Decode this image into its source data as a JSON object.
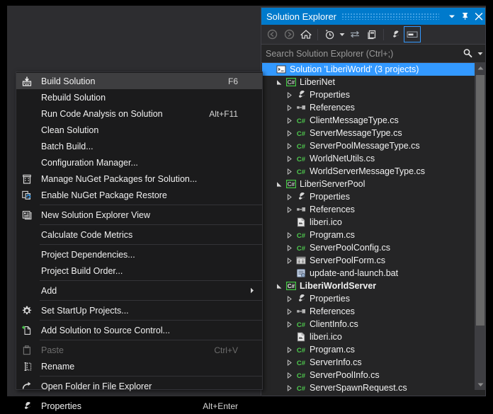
{
  "context_menu": {
    "items": [
      {
        "label": "Build Solution",
        "shortcut": "F6",
        "icon": "build-solution-icon",
        "highlighted": true,
        "disabled": false,
        "submenu": false,
        "sep_after": false
      },
      {
        "label": "Rebuild Solution",
        "shortcut": "",
        "icon": "",
        "highlighted": false,
        "disabled": false,
        "submenu": false,
        "sep_after": false
      },
      {
        "label": "Run Code Analysis on Solution",
        "shortcut": "Alt+F11",
        "icon": "",
        "highlighted": false,
        "disabled": false,
        "submenu": false,
        "sep_after": false
      },
      {
        "label": "Clean Solution",
        "shortcut": "",
        "icon": "",
        "highlighted": false,
        "disabled": false,
        "submenu": false,
        "sep_after": false
      },
      {
        "label": "Batch Build...",
        "shortcut": "",
        "icon": "",
        "highlighted": false,
        "disabled": false,
        "submenu": false,
        "sep_after": false
      },
      {
        "label": "Configuration Manager...",
        "shortcut": "",
        "icon": "",
        "highlighted": false,
        "disabled": false,
        "submenu": false,
        "sep_after": false
      },
      {
        "label": "Manage NuGet Packages for Solution...",
        "shortcut": "",
        "icon": "nuget-package-icon",
        "highlighted": false,
        "disabled": false,
        "submenu": false,
        "sep_after": false
      },
      {
        "label": "Enable NuGet Package Restore",
        "shortcut": "",
        "icon": "nuget-restore-icon",
        "highlighted": false,
        "disabled": false,
        "submenu": false,
        "sep_after": true
      },
      {
        "label": "New Solution Explorer View",
        "shortcut": "",
        "icon": "new-view-icon",
        "highlighted": false,
        "disabled": false,
        "submenu": false,
        "sep_after": true
      },
      {
        "label": "Calculate Code Metrics",
        "shortcut": "",
        "icon": "",
        "highlighted": false,
        "disabled": false,
        "submenu": false,
        "sep_after": true
      },
      {
        "label": "Project Dependencies...",
        "shortcut": "",
        "icon": "",
        "highlighted": false,
        "disabled": false,
        "submenu": false,
        "sep_after": false
      },
      {
        "label": "Project Build Order...",
        "shortcut": "",
        "icon": "",
        "highlighted": false,
        "disabled": false,
        "submenu": false,
        "sep_after": true
      },
      {
        "label": "Add",
        "shortcut": "",
        "icon": "",
        "highlighted": false,
        "disabled": false,
        "submenu": true,
        "sep_after": true
      },
      {
        "label": "Set StartUp Projects...",
        "shortcut": "",
        "icon": "gear-icon",
        "highlighted": false,
        "disabled": false,
        "submenu": false,
        "sep_after": true
      },
      {
        "label": "Add Solution to Source Control...",
        "shortcut": "",
        "icon": "add-source-control-icon",
        "highlighted": false,
        "disabled": false,
        "submenu": false,
        "sep_after": true
      },
      {
        "label": "Paste",
        "shortcut": "Ctrl+V",
        "icon": "paste-icon",
        "highlighted": false,
        "disabled": true,
        "submenu": false,
        "sep_after": false
      },
      {
        "label": "Rename",
        "shortcut": "",
        "icon": "rename-icon",
        "highlighted": false,
        "disabled": false,
        "submenu": false,
        "sep_after": true
      },
      {
        "label": "Open Folder in File Explorer",
        "shortcut": "",
        "icon": "open-folder-icon",
        "highlighted": false,
        "disabled": false,
        "submenu": false,
        "sep_after": true
      },
      {
        "label": "Properties",
        "shortcut": "Alt+Enter",
        "icon": "wrench-icon",
        "highlighted": false,
        "disabled": false,
        "submenu": false,
        "sep_after": false
      }
    ]
  },
  "solution_explorer": {
    "title": "Solution Explorer",
    "title_buttons": [
      "dropdown-icon",
      "pin-icon",
      "close-icon"
    ],
    "toolbar": [
      {
        "name": "back-button",
        "enabled": false
      },
      {
        "name": "forward-button",
        "enabled": false
      },
      {
        "name": "home-button",
        "enabled": true
      },
      {
        "name": "pending-changes-button",
        "enabled": true
      },
      {
        "name": "sync-with-active-document-button",
        "enabled": true
      },
      {
        "name": "show-all-files-button",
        "enabled": true
      },
      {
        "name": "properties-button",
        "enabled": true
      },
      {
        "name": "preview-selected-items-button",
        "enabled": true,
        "selected": true
      }
    ],
    "search": {
      "placeholder": "Search Solution Explorer (Ctrl+;)",
      "value": ""
    },
    "accent_color": "#3399ff",
    "title_bar_color": "#007acc",
    "tree": [
      {
        "label": "Solution 'LiberiWorld' (3 projects)",
        "depth": 0,
        "twisty": "",
        "icon": "solution-icon",
        "selected": true,
        "bold": false
      },
      {
        "label": "LiberiNet",
        "depth": 1,
        "twisty": "expanded",
        "icon": "csharp-project-icon",
        "selected": false,
        "bold": false
      },
      {
        "label": "Properties",
        "depth": 2,
        "twisty": "collapsed",
        "icon": "wrench-icon",
        "selected": false,
        "bold": false
      },
      {
        "label": "References",
        "depth": 2,
        "twisty": "collapsed",
        "icon": "references-icon",
        "selected": false,
        "bold": false
      },
      {
        "label": "ClientMessageType.cs",
        "depth": 2,
        "twisty": "collapsed",
        "icon": "csharp-file-icon",
        "selected": false,
        "bold": false
      },
      {
        "label": "ServerMessageType.cs",
        "depth": 2,
        "twisty": "collapsed",
        "icon": "csharp-file-icon",
        "selected": false,
        "bold": false
      },
      {
        "label": "ServerPoolMessageType.cs",
        "depth": 2,
        "twisty": "collapsed",
        "icon": "csharp-file-icon",
        "selected": false,
        "bold": false
      },
      {
        "label": "WorldNetUtils.cs",
        "depth": 2,
        "twisty": "collapsed",
        "icon": "csharp-file-icon",
        "selected": false,
        "bold": false
      },
      {
        "label": "WorldServerMessageType.cs",
        "depth": 2,
        "twisty": "collapsed",
        "icon": "csharp-file-icon",
        "selected": false,
        "bold": false
      },
      {
        "label": "LiberiServerPool",
        "depth": 1,
        "twisty": "expanded",
        "icon": "csharp-project-icon",
        "selected": false,
        "bold": false
      },
      {
        "label": "Properties",
        "depth": 2,
        "twisty": "collapsed",
        "icon": "wrench-icon",
        "selected": false,
        "bold": false
      },
      {
        "label": "References",
        "depth": 2,
        "twisty": "collapsed",
        "icon": "references-icon",
        "selected": false,
        "bold": false
      },
      {
        "label": "liberi.ico",
        "depth": 2,
        "twisty": "",
        "icon": "ico-file-icon",
        "selected": false,
        "bold": false
      },
      {
        "label": "Program.cs",
        "depth": 2,
        "twisty": "collapsed",
        "icon": "csharp-file-icon",
        "selected": false,
        "bold": false
      },
      {
        "label": "ServerPoolConfig.cs",
        "depth": 2,
        "twisty": "collapsed",
        "icon": "csharp-file-icon",
        "selected": false,
        "bold": false
      },
      {
        "label": "ServerPoolForm.cs",
        "depth": 2,
        "twisty": "collapsed",
        "icon": "form-file-icon",
        "selected": false,
        "bold": false
      },
      {
        "label": "update-and-launch.bat",
        "depth": 2,
        "twisty": "",
        "icon": "bat-file-icon",
        "selected": false,
        "bold": false
      },
      {
        "label": "LiberiWorldServer",
        "depth": 1,
        "twisty": "expanded",
        "icon": "csharp-project-icon",
        "selected": false,
        "bold": true
      },
      {
        "label": "Properties",
        "depth": 2,
        "twisty": "collapsed",
        "icon": "wrench-icon",
        "selected": false,
        "bold": false
      },
      {
        "label": "References",
        "depth": 2,
        "twisty": "collapsed",
        "icon": "references-icon",
        "selected": false,
        "bold": false
      },
      {
        "label": "ClientInfo.cs",
        "depth": 2,
        "twisty": "collapsed",
        "icon": "csharp-file-icon",
        "selected": false,
        "bold": false
      },
      {
        "label": "liberi.ico",
        "depth": 2,
        "twisty": "",
        "icon": "ico-file-icon",
        "selected": false,
        "bold": false
      },
      {
        "label": "Program.cs",
        "depth": 2,
        "twisty": "collapsed",
        "icon": "csharp-file-icon",
        "selected": false,
        "bold": false
      },
      {
        "label": "ServerInfo.cs",
        "depth": 2,
        "twisty": "collapsed",
        "icon": "csharp-file-icon",
        "selected": false,
        "bold": false
      },
      {
        "label": "ServerPoolInfo.cs",
        "depth": 2,
        "twisty": "collapsed",
        "icon": "csharp-file-icon",
        "selected": false,
        "bold": false
      },
      {
        "label": "ServerSpawnRequest.cs",
        "depth": 2,
        "twisty": "collapsed",
        "icon": "csharp-file-icon",
        "selected": false,
        "bold": false
      }
    ]
  }
}
